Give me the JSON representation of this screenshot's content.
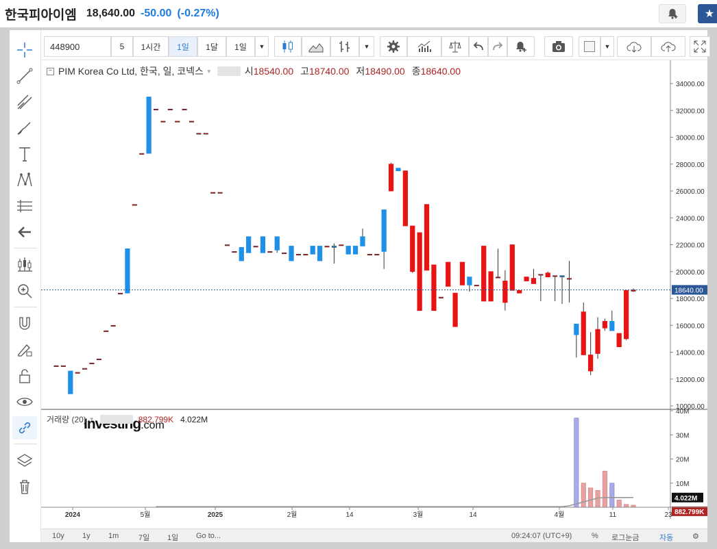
{
  "quote": {
    "name": "한국피아이엠",
    "price": "18,640.00",
    "change": "-50.00",
    "change_pct": "(-0.27%)"
  },
  "toolbar": {
    "symbol": "448900",
    "btn_5": "5",
    "btn_1h": "1시간",
    "btn_1d": "1일",
    "btn_1mo": "1달",
    "btn_interval": "1일",
    "active_interval": "1일"
  },
  "legend": {
    "title": "PIM Korea Co Ltd, 한국, 일, 코넥스",
    "open_label": "시",
    "open": "18540.00",
    "high_label": "고",
    "high": "18740.00",
    "low_label": "저",
    "low": "18490.00",
    "close_label": "종",
    "close": "18640.00"
  },
  "volume_legend": {
    "title": "거래량 (20)",
    "value": "882.799K",
    "ma": "4.022M"
  },
  "logo": {
    "main": "Investing",
    "suffix": ".com"
  },
  "bottom": {
    "ranges": [
      "10y",
      "1y",
      "1m",
      "7일",
      "1일"
    ],
    "goto": "Go to...",
    "time": "09:24:07 (UTC+9)",
    "pct": "%",
    "log": "로그눈금",
    "auto": "자동"
  },
  "colors": {
    "up": "#e81414",
    "down": "#1e90e8",
    "vol_up": "#e8a0a0",
    "vol_down": "#a9a9e6",
    "accent": "#2b7cd3"
  },
  "chart_data": {
    "type": "candlestick",
    "price_axis": {
      "min": 10000,
      "max": 34000,
      "ticks": [
        "34000.00",
        "32000.00",
        "30000.00",
        "28000.00",
        "26000.00",
        "24000.00",
        "22000.00",
        "20000.00",
        "18000.00",
        "16000.00",
        "14000.00",
        "12000.00",
        "10000.00"
      ],
      "last_price_label": "18640.00",
      "last_price": 18640
    },
    "volume_axis": {
      "ticks": [
        "40M",
        "30M",
        "20M",
        "10M"
      ],
      "ma_label": "4.022M",
      "ma_value": 4.022,
      "vol_label": "882.799K",
      "vol_value": 0.883,
      "max": 40
    },
    "x_ticks": [
      "2024",
      "5월",
      "2025",
      "2월",
      "14",
      "3월",
      "14",
      "4월",
      "11",
      "23"
    ],
    "candles": [
      {
        "o": 13000,
        "h": 13000,
        "l": 13000,
        "c": 13000
      },
      {
        "o": 13000,
        "h": 13000,
        "l": 13000,
        "c": 13000
      },
      {
        "o": 12600,
        "h": 12600,
        "l": 10900,
        "c": 10900
      },
      {
        "o": 12500,
        "h": 12500,
        "l": 12500,
        "c": 12500
      },
      {
        "o": 12800,
        "h": 12800,
        "l": 12800,
        "c": 12800
      },
      {
        "o": 13200,
        "h": 13200,
        "l": 13200,
        "c": 13200
      },
      {
        "o": 13500,
        "h": 13500,
        "l": 13500,
        "c": 13500
      },
      {
        "o": 15600,
        "h": 15600,
        "l": 15600,
        "c": 15600
      },
      {
        "o": 16000,
        "h": 16000,
        "l": 16000,
        "c": 16000
      },
      {
        "o": 18400,
        "h": 18400,
        "l": 18400,
        "c": 18400
      },
      {
        "o": 21700,
        "h": 21700,
        "l": 18400,
        "c": 18400
      },
      {
        "o": 25000,
        "h": 25000,
        "l": 25000,
        "c": 25000
      },
      {
        "o": 28800,
        "h": 28800,
        "l": 28800,
        "c": 28800
      },
      {
        "o": 33000,
        "h": 33000,
        "l": 28800,
        "c": 28800
      },
      {
        "o": 32100,
        "h": 32100,
        "l": 32100,
        "c": 32100
      },
      {
        "o": 31200,
        "h": 31200,
        "l": 31200,
        "c": 31200
      },
      {
        "o": 32100,
        "h": 32100,
        "l": 32100,
        "c": 32100
      },
      {
        "o": 31200,
        "h": 31200,
        "l": 31200,
        "c": 31200
      },
      {
        "o": 32100,
        "h": 32100,
        "l": 32100,
        "c": 32100
      },
      {
        "o": 31200,
        "h": 31200,
        "l": 31200,
        "c": 31200
      },
      {
        "o": 30300,
        "h": 30300,
        "l": 30300,
        "c": 30300
      },
      {
        "o": 30300,
        "h": 30300,
        "l": 30300,
        "c": 30300
      },
      {
        "o": 25900,
        "h": 25900,
        "l": 25900,
        "c": 25900
      },
      {
        "o": 25900,
        "h": 25900,
        "l": 25900,
        "c": 25900
      },
      {
        "o": 22000,
        "h": 22000,
        "l": 22000,
        "c": 22000
      },
      {
        "o": 21500,
        "h": 21500,
        "l": 21500,
        "c": 21500
      },
      {
        "o": 21800,
        "h": 21800,
        "l": 20800,
        "c": 20800
      },
      {
        "o": 22600,
        "h": 22600,
        "l": 21400,
        "c": 21400
      },
      {
        "o": 21900,
        "h": 21900,
        "l": 21900,
        "c": 21900
      },
      {
        "o": 22600,
        "h": 22600,
        "l": 21400,
        "c": 21400
      },
      {
        "o": 21500,
        "h": 21500,
        "l": 21500,
        "c": 21500
      },
      {
        "o": 22600,
        "h": 22600,
        "l": 21400,
        "c": 21600
      },
      {
        "o": 21400,
        "h": 21400,
        "l": 21400,
        "c": 21400
      },
      {
        "o": 21900,
        "h": 21900,
        "l": 20800,
        "c": 20800
      },
      {
        "o": 21300,
        "h": 21300,
        "l": 21200,
        "c": 21300
      },
      {
        "o": 21300,
        "h": 21300,
        "l": 21300,
        "c": 21300
      },
      {
        "o": 21900,
        "h": 21900,
        "l": 21300,
        "c": 21300
      },
      {
        "o": 21900,
        "h": 21900,
        "l": 20800,
        "c": 20800
      },
      {
        "o": 21900,
        "h": 21900,
        "l": 21900,
        "c": 21900
      },
      {
        "o": 21900,
        "h": 22100,
        "l": 20600,
        "c": 21800
      },
      {
        "o": 22000,
        "h": 22000,
        "l": 22000,
        "c": 22000
      },
      {
        "o": 21900,
        "h": 21900,
        "l": 21300,
        "c": 21300
      },
      {
        "o": 21900,
        "h": 21900,
        "l": 21300,
        "c": 21300
      },
      {
        "o": 22600,
        "h": 23200,
        "l": 21900,
        "c": 21900
      },
      {
        "o": 21300,
        "h": 21300,
        "l": 21300,
        "c": 21300
      },
      {
        "o": 21300,
        "h": 21300,
        "l": 21300,
        "c": 21300
      },
      {
        "o": 24600,
        "h": 24600,
        "l": 20200,
        "c": 21500
      },
      {
        "o": 26000,
        "h": 28100,
        "l": 26000,
        "c": 28000
      },
      {
        "o": 27700,
        "h": 27700,
        "l": 27500,
        "c": 27500
      },
      {
        "o": 23400,
        "h": 27500,
        "l": 23400,
        "c": 27500
      },
      {
        "o": 20000,
        "h": 23400,
        "l": 19900,
        "c": 23400
      },
      {
        "o": 17100,
        "h": 22900,
        "l": 17100,
        "c": 22900
      },
      {
        "o": 20100,
        "h": 25000,
        "l": 20100,
        "c": 25000
      },
      {
        "o": 17100,
        "h": 20500,
        "l": 17100,
        "c": 20500
      },
      {
        "o": 18100,
        "h": 18100,
        "l": 18000,
        "c": 18100
      },
      {
        "o": 18900,
        "h": 20700,
        "l": 18900,
        "c": 20700
      },
      {
        "o": 15900,
        "h": 18400,
        "l": 15900,
        "c": 18400
      },
      {
        "o": 19000,
        "h": 20700,
        "l": 19000,
        "c": 20700
      },
      {
        "o": 19600,
        "h": 19600,
        "l": 18500,
        "c": 19000
      },
      {
        "o": 19000,
        "h": 19000,
        "l": 19000,
        "c": 19000
      },
      {
        "o": 17800,
        "h": 21900,
        "l": 17800,
        "c": 21900
      },
      {
        "o": 17800,
        "h": 20000,
        "l": 17800,
        "c": 20000
      },
      {
        "o": 19600,
        "h": 21700,
        "l": 19600,
        "c": 19600
      },
      {
        "o": 17700,
        "h": 20100,
        "l": 17100,
        "c": 19300
      },
      {
        "o": 18600,
        "h": 22000,
        "l": 18600,
        "c": 22000
      },
      {
        "o": 18400,
        "h": 18600,
        "l": 18400,
        "c": 18600
      },
      {
        "o": 19300,
        "h": 19600,
        "l": 19300,
        "c": 19600
      },
      {
        "o": 19100,
        "h": 20200,
        "l": 19100,
        "c": 19500
      },
      {
        "o": 19800,
        "h": 19800,
        "l": 17800,
        "c": 19800
      },
      {
        "o": 19600,
        "h": 20000,
        "l": 19600,
        "c": 19900
      },
      {
        "o": 19700,
        "h": 19700,
        "l": 17800,
        "c": 19700
      },
      {
        "o": 19700,
        "h": 19700,
        "l": 17600,
        "c": 19600
      },
      {
        "o": 19500,
        "h": 20800,
        "l": 17700,
        "c": 19500
      },
      {
        "o": 16100,
        "h": 16100,
        "l": 13600,
        "c": 15300
      },
      {
        "o": 13800,
        "h": 17700,
        "l": 13800,
        "c": 17000
      },
      {
        "o": 12600,
        "h": 15500,
        "l": 12300,
        "c": 13800
      },
      {
        "o": 13900,
        "h": 16600,
        "l": 13500,
        "c": 15700
      },
      {
        "o": 15800,
        "h": 16500,
        "l": 15600,
        "c": 16300
      },
      {
        "o": 16300,
        "h": 17100,
        "l": 15700,
        "c": 15600
      },
      {
        "o": 14400,
        "h": 15400,
        "l": 14400,
        "c": 15400
      },
      {
        "o": 15000,
        "h": 18600,
        "l": 14900,
        "c": 18600
      },
      {
        "o": 18540,
        "h": 18740,
        "l": 18490,
        "c": 18640
      }
    ],
    "volume": [
      0,
      0,
      0,
      0,
      0,
      0,
      0,
      0,
      0,
      0,
      0,
      0,
      0,
      0,
      0,
      0,
      0,
      0,
      0,
      0,
      0,
      0,
      0,
      0,
      0,
      0,
      0,
      0,
      0,
      0,
      0,
      0,
      0,
      0,
      0,
      0,
      0,
      0,
      0,
      0,
      0,
      0,
      0,
      0,
      0,
      0,
      0,
      0,
      0,
      0,
      0,
      0,
      0,
      0,
      0,
      0,
      0,
      0,
      0,
      0,
      0,
      0,
      0,
      0,
      0,
      0,
      0,
      0,
      0,
      0,
      0,
      0,
      0,
      37,
      10,
      8,
      7,
      15,
      10,
      3,
      1.2,
      0.88
    ],
    "volume_ma": 4.022
  }
}
